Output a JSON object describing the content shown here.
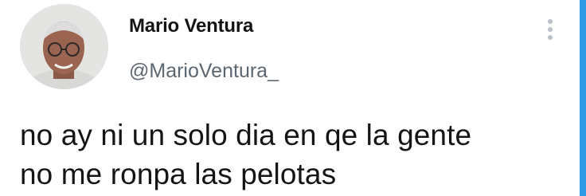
{
  "tweet": {
    "author": {
      "display_name": "Mario Ventura",
      "handle": "@MarioVentura_"
    },
    "text_lines": [
      "no ay ni un solo dia en qe la gente",
      "no me ronpa las pelotas"
    ],
    "more_icon": "more-vertical-icon"
  },
  "colors": {
    "text": "#151515",
    "handle": "#5b6670",
    "more_icon": "#b9c2ca",
    "edge_strip": "#2f9ae3"
  }
}
